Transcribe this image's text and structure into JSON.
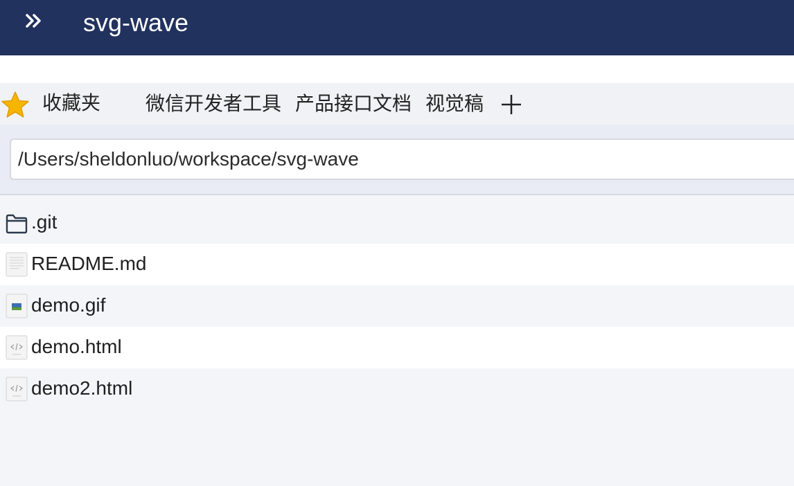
{
  "titlebar": {
    "title": "svg-wave",
    "expand_icon": "double-chevron-right-icon"
  },
  "favorites": {
    "label": "收藏夹",
    "icon": "star-icon",
    "links": [
      {
        "label": "微信开发者工具"
      },
      {
        "label": "产品接口文档"
      },
      {
        "label": "视觉稿"
      }
    ],
    "add_icon": "plus-icon"
  },
  "path": {
    "value": "/Users/sheldonluo/workspace/svg-wave"
  },
  "files": [
    {
      "name": ".git",
      "icon": "folder-icon"
    },
    {
      "name": "README.md",
      "icon": "text-file-icon"
    },
    {
      "name": "demo.gif",
      "icon": "image-file-icon"
    },
    {
      "name": "demo.html",
      "icon": "html-file-icon"
    },
    {
      "name": "demo2.html",
      "icon": "html-file-icon"
    }
  ],
  "colors": {
    "titlebar_bg": "#22325e",
    "star": "#f7b500"
  }
}
